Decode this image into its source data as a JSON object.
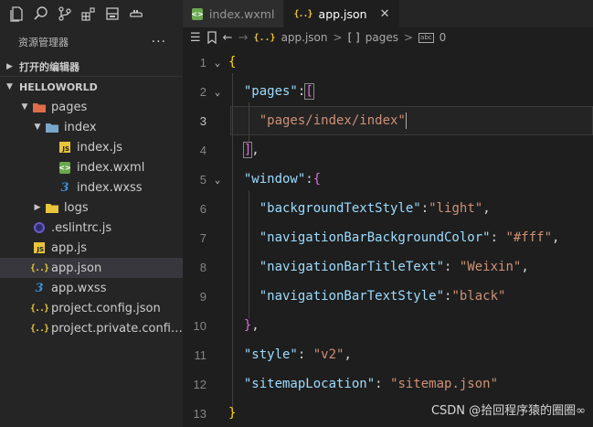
{
  "activity_bar": {
    "icons": [
      "files-icon",
      "search-icon",
      "source-control-icon",
      "extensions-icon",
      "storage-icon",
      "cloud-icon"
    ]
  },
  "explorer": {
    "title": "资源管理器",
    "more": "···",
    "open_editors_label": "打开的编辑器",
    "project_label": "HELLOWORLD",
    "tree": [
      {
        "label": "pages",
        "type": "folder-open",
        "depth": 0
      },
      {
        "label": "index",
        "type": "folder-open",
        "depth": 1
      },
      {
        "label": "index.js",
        "type": "js",
        "depth": 2
      },
      {
        "label": "index.wxml",
        "type": "wxml",
        "depth": 2
      },
      {
        "label": "index.wxss",
        "type": "wxss",
        "depth": 2
      },
      {
        "label": "logs",
        "type": "folder-closed",
        "depth": 1
      },
      {
        "label": ".eslintrc.js",
        "type": "eslint",
        "depth": 0
      },
      {
        "label": "app.js",
        "type": "js",
        "depth": 0
      },
      {
        "label": "app.json",
        "type": "json",
        "depth": 0,
        "selected": true
      },
      {
        "label": "app.wxss",
        "type": "wxss",
        "depth": 0
      },
      {
        "label": "project.config.json",
        "type": "json",
        "depth": 0
      },
      {
        "label": "project.private.config.js...",
        "type": "json",
        "depth": 0
      }
    ]
  },
  "tabs": [
    {
      "label": "index.wxml",
      "active": false
    },
    {
      "label": "app.json",
      "active": true
    }
  ],
  "breadcrumb": {
    "file": "app.json",
    "sep1": ">",
    "array_icon": "[ ]",
    "key": "pages",
    "sep2": ">",
    "index_icon": "abc",
    "index": "0"
  },
  "code_lines": [
    {
      "n": "1",
      "fold": true
    },
    {
      "n": "2",
      "fold": true
    },
    {
      "n": "3",
      "fold": false
    },
    {
      "n": "4",
      "fold": false
    },
    {
      "n": "5",
      "fold": true
    },
    {
      "n": "6",
      "fold": false
    },
    {
      "n": "7",
      "fold": false
    },
    {
      "n": "8",
      "fold": false
    },
    {
      "n": "9",
      "fold": false
    },
    {
      "n": "10",
      "fold": false
    },
    {
      "n": "11",
      "fold": false
    },
    {
      "n": "12",
      "fold": false
    },
    {
      "n": "13",
      "fold": false
    }
  ],
  "code": {
    "l1": "{",
    "l2_key": "\"pages\"",
    "l2_colon": ":",
    "l2_open": "[",
    "l3_val": "\"pages/index/index\"",
    "l4_close": "]",
    "l4_comma": ",",
    "l5_key": "\"window\"",
    "l5_colon": ":",
    "l5_open": "{",
    "l6_key": "\"backgroundTextStyle\"",
    "l6_colon": ":",
    "l6_val": "\"light\"",
    "l6_comma": ",",
    "l7_key": "\"navigationBarBackgroundColor\"",
    "l7_colon": ": ",
    "l7_val": "\"#fff\"",
    "l7_comma": ",",
    "l8_key": "\"navigationBarTitleText\"",
    "l8_colon": ": ",
    "l8_val": "\"Weixin\"",
    "l8_comma": ",",
    "l9_key": "\"navigationBarTextStyle\"",
    "l9_colon": ":",
    "l9_val": "\"black\"",
    "l10_close": "}",
    "l10_comma": ",",
    "l11_key": "\"style\"",
    "l11_colon": ": ",
    "l11_val": "\"v2\"",
    "l11_comma": ",",
    "l12_key": "\"sitemapLocation\"",
    "l12_colon": ": ",
    "l12_val": "\"sitemap.json\"",
    "l13": "}"
  },
  "current_line": "3",
  "watermark": "CSDN @拾回程序猿的圈圈∞",
  "colors": {
    "accent_json": "#e8c53a",
    "key": "#9cdcfe",
    "string": "#ce9178",
    "brace": "#ffd700",
    "bracket": "#da70d6"
  }
}
